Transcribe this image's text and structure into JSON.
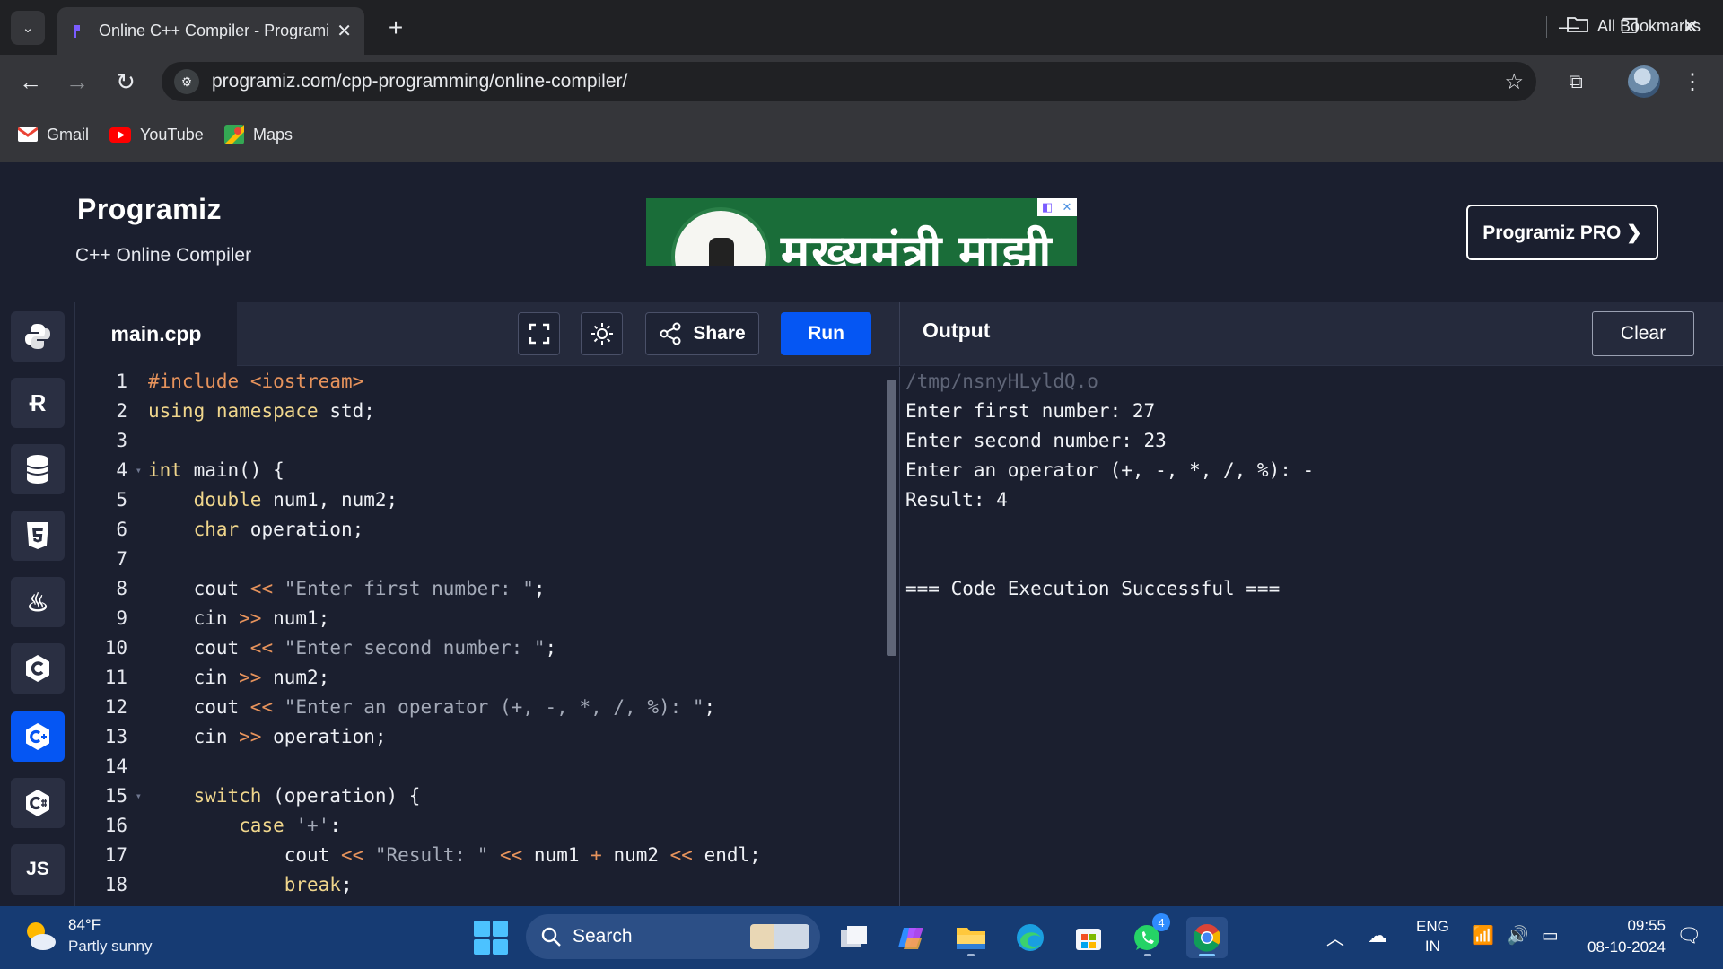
{
  "browser": {
    "tab_title": "Online C++ Compiler - Programiz",
    "url": "programiz.com/cpp-programming/online-compiler/",
    "bookmarks": [
      {
        "label": "Gmail",
        "icon": "gmail-icon"
      },
      {
        "label": "YouTube",
        "icon": "youtube-icon"
      },
      {
        "label": "Maps",
        "icon": "maps-icon"
      }
    ],
    "all_bookmarks": "All Bookmarks"
  },
  "header": {
    "logo": "Programiz",
    "subtitle": "C++ Online Compiler",
    "ad_text": "मुख्यमंत्री माझी",
    "pro_button": "Programiz PRO ❯"
  },
  "languages": [
    {
      "name": "python-icon",
      "glyph": "🐍"
    },
    {
      "name": "r-icon",
      "glyph": "R"
    },
    {
      "name": "sql-icon",
      "glyph": "≋"
    },
    {
      "name": "html-icon",
      "glyph": "5"
    },
    {
      "name": "java-icon",
      "glyph": "☕"
    },
    {
      "name": "c-icon",
      "glyph": "C"
    },
    {
      "name": "cpp-icon",
      "glyph": "C+",
      "active": true
    },
    {
      "name": "csharp-icon",
      "glyph": "C#"
    },
    {
      "name": "js-icon",
      "glyph": "JS"
    }
  ],
  "editor": {
    "file_name": "main.cpp",
    "share_label": "Share",
    "run_label": "Run",
    "line_numbers": [
      "1",
      "2",
      "3",
      "4",
      "5",
      "6",
      "7",
      "8",
      "9",
      "10",
      "11",
      "12",
      "13",
      "14",
      "15",
      "16",
      "17",
      "18"
    ],
    "code": [
      "#include <iostream>",
      "using namespace std;",
      "",
      "int main() {",
      "    double num1, num2;",
      "    char operation;",
      "",
      "    cout << \"Enter first number: \";",
      "    cin >> num1;",
      "    cout << \"Enter second number: \";",
      "    cin >> num2;",
      "    cout << \"Enter an operator (+, -, *, /, %): \";",
      "    cin >> operation;",
      "",
      "    switch (operation) {",
      "        case '+':",
      "            cout << \"Result: \" << num1 + num2 << endl;",
      "            break;"
    ]
  },
  "output": {
    "title": "Output",
    "clear_label": "Clear",
    "path": "/tmp/nsnyHLyldQ.o",
    "lines": [
      "Enter first number: 27",
      "Enter second number: 23",
      "Enter an operator (+, -, *, /, %): -",
      "Result: 4"
    ],
    "status": "=== Code Execution Successful ==="
  },
  "taskbar": {
    "temperature": "84°F",
    "weather": "Partly sunny",
    "search_label": "Search",
    "language_line1": "ENG",
    "language_line2": "IN",
    "time": "09:55",
    "date": "08-10-2024",
    "whatsapp_badge": "4"
  },
  "colors": {
    "accent": "#0556f3",
    "editor_bg": "#1b1f2f",
    "keyword": "#f0d68c",
    "string": "#a4aab8",
    "preprocessor": "#e7935c"
  }
}
